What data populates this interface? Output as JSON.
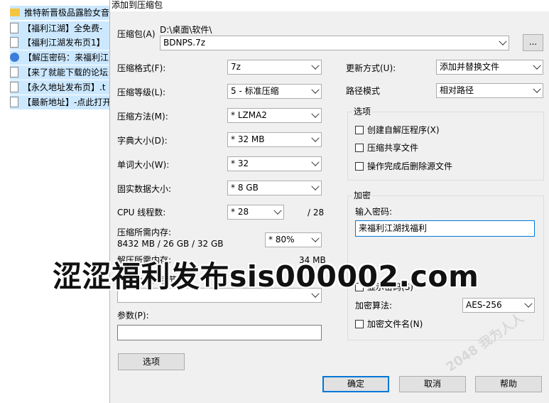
{
  "file_list": [
    {
      "name": "推特新晋极品露脸女音",
      "icon": "folder-icon"
    },
    {
      "name": "【福利江湖】全免费-",
      "icon": "doc-icon"
    },
    {
      "name": "【福利江湖发布页1】",
      "icon": "doc-icon"
    },
    {
      "name": "【解压密码：来福利江",
      "icon": "jpg-icon"
    },
    {
      "name": "【来了就能下载的论坛",
      "icon": "doc-icon"
    },
    {
      "name": "【永久地址发布页】.t",
      "icon": "doc-icon"
    },
    {
      "name": "【最新地址】-点此打开",
      "icon": "doc-icon"
    }
  ],
  "dialog": {
    "title": "添加到压缩包",
    "archive_label": "压缩包(A)",
    "archive_path": "D:\\桌面\\软件\\",
    "archive_name": "BDNPS.7z",
    "browse_label": "...",
    "format_label": "压缩格式(F):",
    "format_value": "7z",
    "level_label": "压缩等级(L):",
    "level_value": "5 - 标准压缩",
    "method_label": "压缩方法(M):",
    "method_value": "* LZMA2",
    "dict_label": "字典大小(D):",
    "dict_value": "* 32 MB",
    "word_label": "单词大小(W):",
    "word_value": "* 32",
    "solid_label": "固实数据大小:",
    "solid_value": "* 8 GB",
    "cpu_label": "CPU 线程数:",
    "cpu_value": "* 28",
    "cpu_total": "/ 28",
    "mem_comp_label": "压缩所需内存:",
    "mem_comp_value": "8432 MB / 26 GB / 32 GB",
    "mem_percent": "* 80%",
    "mem_decomp_label": "解压所需内存:",
    "mem_decomp_value": "34 MB",
    "split_label": "分卷大小，字节(V):",
    "params_label": "参数(P):",
    "options_button": "选项",
    "update_label": "更新方式(U):",
    "update_value": "添加并替换文件",
    "path_mode_label": "路径模式",
    "path_mode_value": "相对路径",
    "options_group": "选项",
    "opt_sfx": "创建自解压程序(X)",
    "opt_shared": "压缩共享文件",
    "opt_delete": "操作完成后删除源文件",
    "encrypt_group": "加密",
    "password_label": "输入密码:",
    "password_value": "来福利江湖找福利",
    "show_password": "显示密码(S)",
    "enc_method_label": "加密算法:",
    "enc_method_value": "AES-256",
    "encrypt_names": "加密文件名(N)",
    "ok": "确定",
    "cancel": "取消",
    "help": "帮助"
  },
  "watermark": "涩涩福利发布sis000002.com",
  "stamp": "2048 我为人人"
}
